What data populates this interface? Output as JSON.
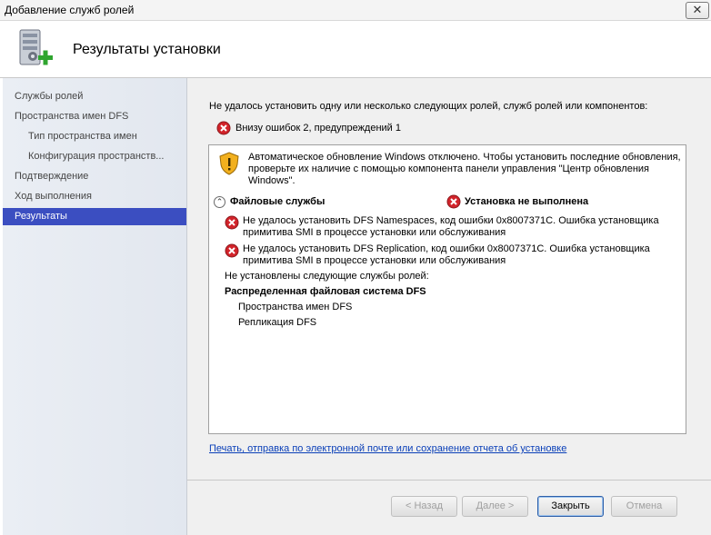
{
  "window": {
    "title": "Добавление служб ролей",
    "close_glyph": "✕"
  },
  "header": {
    "title": "Результаты установки",
    "icon": "server-add-icon"
  },
  "nav": {
    "items": [
      {
        "label": "Службы ролей"
      },
      {
        "label": "Пространства имен DFS"
      },
      {
        "label": "Тип пространства имен"
      },
      {
        "label": "Конфигурация пространств..."
      },
      {
        "label": "Подтверждение"
      },
      {
        "label": "Ход выполнения"
      },
      {
        "label": "Результаты"
      }
    ],
    "active_index": 6,
    "active_color": "#3b4ec1"
  },
  "main": {
    "intro": "Не удалось установить одну или несколько следующих ролей, служб ролей или компонентов:",
    "summary": "Внизу ошибок 2, предупреждений 1",
    "warning": "Автоматическое обновление Windows отключено. Чтобы установить последние обновления, проверьте их наличие с помощью компонента панели управления \"Центр обновления Windows\".",
    "section": {
      "name": "Файловые службы",
      "status": "Установка не выполнена"
    },
    "errors": [
      "Не удалось установить DFS Namespaces, код ошибки 0x8007371C.  Ошибка установщика примитива SMI в процессе установки или обслуживания",
      "Не удалось установить DFS Replication, код ошибки 0x8007371C.  Ошибка установщика примитива SMI в процессе установки или обслуживания"
    ],
    "not_installed_label": "Не установлены следующие службы ролей:",
    "group": "Распределенная файловая система DFS",
    "services": [
      "Пространства имен DFS",
      "Репликация DFS"
    ],
    "report_link": "Печать, отправка по электронной почте или сохранение отчета об установке"
  },
  "buttons": {
    "back": "< Назад",
    "next": "Далее >",
    "close": "Закрыть",
    "cancel": "Отмена"
  },
  "colors": {
    "error": "#d2232a",
    "warning": "#f2b01e",
    "link": "#0a3fb8"
  }
}
